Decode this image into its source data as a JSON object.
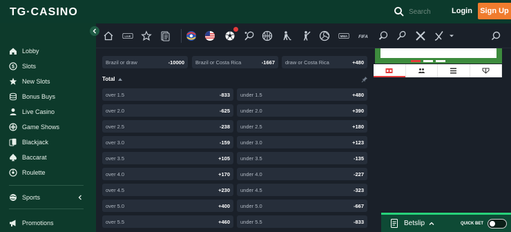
{
  "header": {
    "logo": "TG·CASINO",
    "search_placeholder": "Search",
    "login_label": "Login",
    "signup_label": "Sign Up"
  },
  "sidebar": {
    "items": [
      {
        "label": "Lobby",
        "icon": "home-icon"
      },
      {
        "label": "Slots",
        "icon": "dollar-icon"
      },
      {
        "label": "New Slots",
        "icon": "star-icon"
      },
      {
        "label": "Bonus Buys",
        "icon": "coins-icon"
      },
      {
        "label": "Live Casino",
        "icon": "person-icon"
      },
      {
        "label": "Game Shows",
        "icon": "wheel-icon"
      },
      {
        "label": "Blackjack",
        "icon": "cards-icon"
      },
      {
        "label": "Baccarat",
        "icon": "spade-icon"
      },
      {
        "label": "Roulette",
        "icon": "roulette-icon"
      }
    ],
    "sports_label": "Sports",
    "promotions_label": "Promotions"
  },
  "sports_nav": {
    "icons": [
      "home-icon",
      "live-icon",
      "favorites-icon",
      "betslip-list-icon",
      "euro-icon",
      "usa-icon",
      "soccer-icon",
      "tennis-icon",
      "basketball-icon",
      "ice-hockey-icon",
      "cricket-icon",
      "volleyball-icon",
      "mma-icon",
      "fifa-icon",
      "table-tennis-icon",
      "badminton-icon",
      "esports-icon",
      "hockey-stick-icon",
      "more-icon"
    ],
    "live_label": "LIVE",
    "mma_label": "MMA",
    "fifa_label": "FIFA"
  },
  "double_chance": [
    {
      "label": "Brazil or draw",
      "odd": "-10000"
    },
    {
      "label": "Brazil or Costa Rica",
      "odd": "-1667"
    },
    {
      "label": "draw or Costa Rica",
      "odd": "+480"
    }
  ],
  "total": {
    "title": "Total",
    "rows": [
      {
        "over_label": "over 1.5",
        "over_odd": "-833",
        "under_label": "under 1.5",
        "under_odd": "+480"
      },
      {
        "over_label": "over 2.0",
        "over_odd": "-625",
        "under_label": "under 2.0",
        "under_odd": "+390"
      },
      {
        "over_label": "over 2.5",
        "over_odd": "-238",
        "under_label": "under 2.5",
        "under_odd": "+180"
      },
      {
        "over_label": "over 3.0",
        "over_odd": "-159",
        "under_label": "under 3.0",
        "under_odd": "+123"
      },
      {
        "over_label": "over 3.5",
        "over_odd": "+105",
        "under_label": "under 3.5",
        "under_odd": "-135"
      },
      {
        "over_label": "over 4.0",
        "over_odd": "+170",
        "under_label": "under 4.0",
        "under_odd": "-227"
      },
      {
        "over_label": "over 4.5",
        "over_odd": "+230",
        "under_label": "under 4.5",
        "under_odd": "-323"
      },
      {
        "over_label": "over 5.0",
        "over_odd": "+400",
        "under_label": "under 5.0",
        "under_odd": "-667"
      },
      {
        "over_label": "over 5.5",
        "over_odd": "+460",
        "under_label": "under 5.5",
        "under_odd": "-833"
      }
    ]
  },
  "right_panel": {
    "tabs": [
      "scoreboard-icon",
      "lineup-icon",
      "stats-list-icon",
      "h2h-icon"
    ]
  },
  "betslip": {
    "label": "Betslip",
    "quick_bet_label": "QUICK BET"
  },
  "colors": {
    "brand_green": "#0d3a2b",
    "accent_orange": "#f07c2e",
    "background": "#1a2029",
    "cell": "#262e3a",
    "betslip_accent": "#27d27a"
  }
}
